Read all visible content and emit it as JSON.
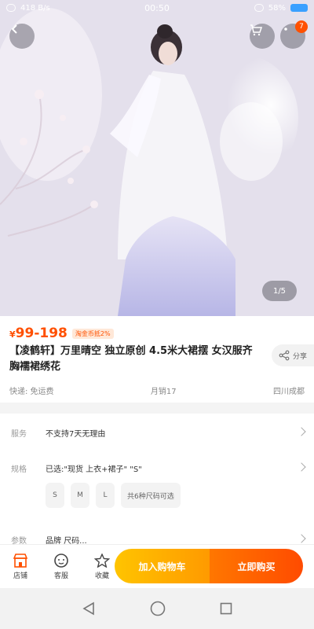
{
  "status_bar": {
    "net_speed": "418 B/s",
    "time": "00:50",
    "battery": "58%"
  },
  "hero": {
    "cart_badge": "7",
    "pager": "1/5"
  },
  "product": {
    "price_symbol": "¥",
    "price_range": "99-198",
    "coin_tag": "淘金币抵2%",
    "title": "【凌鹤轩】万里晴空 独立原创 4.5米大裙摆 女汉服齐胸襦裙绣花",
    "share_label": "分享",
    "shipping": "快递: 免运费",
    "monthly_sales": "月销17",
    "location": "四川成都"
  },
  "options": {
    "service_label": "服务",
    "service_value": "不支持7天无理由",
    "spec_label": "规格",
    "spec_value": "已选:\"现货 上衣+裙子\" \"S\"",
    "chips": [
      "S",
      "M",
      "L",
      "共6种尺码可选"
    ],
    "params_label": "参数",
    "params_value": "品牌 尺码..."
  },
  "actions": {
    "shop": "店铺",
    "service": "客服",
    "favorite": "收藏",
    "add_cart": "加入购物车",
    "buy_now": "立即购买"
  },
  "colors": {
    "accent": "#ff5000",
    "cart_gradient_start": "#ffc400",
    "buy_gradient_end": "#ff4b00"
  }
}
